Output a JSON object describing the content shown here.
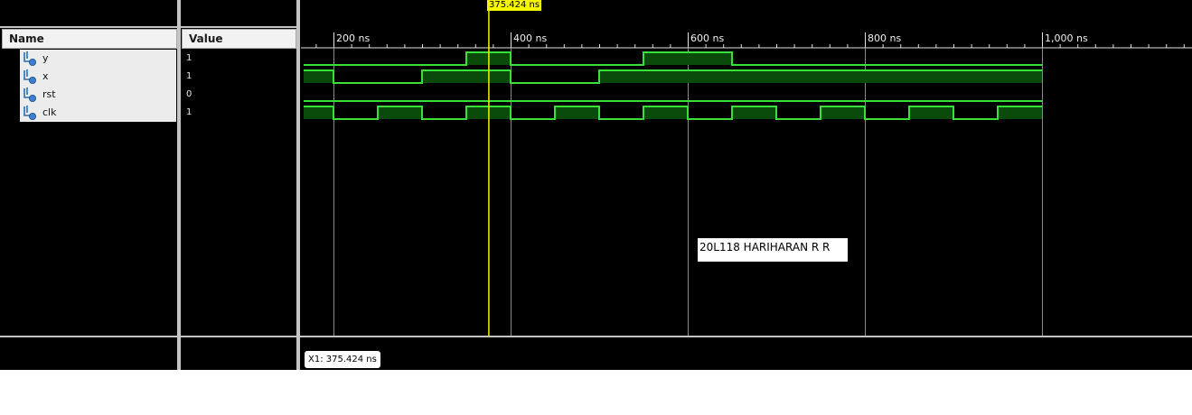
{
  "columns": {
    "name": "Name",
    "value": "Value"
  },
  "signals": [
    {
      "name": "y",
      "value": "1",
      "icon": "signal-bit-icon"
    },
    {
      "name": "x",
      "value": "1",
      "icon": "signal-bit-icon"
    },
    {
      "name": "rst",
      "value": "0",
      "icon": "signal-bit-icon"
    },
    {
      "name": "clk",
      "value": "1",
      "icon": "signal-bit-icon"
    }
  ],
  "timeline": {
    "units": "ns",
    "ticks": [
      "200 ns",
      "400 ns",
      "600 ns",
      "800 ns",
      "1,000 ns"
    ]
  },
  "waveforms": {
    "time_range_ns": [
      167,
      1000
    ],
    "y": [
      [
        167,
        0
      ],
      [
        350,
        1
      ],
      [
        400,
        0
      ],
      [
        550,
        1
      ],
      [
        650,
        0
      ],
      [
        1000,
        0
      ]
    ],
    "x": [
      [
        167,
        1
      ],
      [
        200,
        0
      ],
      [
        300,
        1
      ],
      [
        400,
        0
      ],
      [
        500,
        1
      ],
      [
        1000,
        1
      ]
    ],
    "rst": [
      [
        167,
        0
      ],
      [
        1000,
        0
      ]
    ],
    "clk": [
      [
        167,
        1
      ],
      [
        200,
        0
      ],
      [
        250,
        1
      ],
      [
        300,
        0
      ],
      [
        350,
        1
      ],
      [
        400,
        0
      ],
      [
        450,
        1
      ],
      [
        500,
        0
      ],
      [
        550,
        1
      ],
      [
        600,
        0
      ],
      [
        650,
        1
      ],
      [
        700,
        0
      ],
      [
        750,
        1
      ],
      [
        800,
        0
      ],
      [
        850,
        1
      ],
      [
        900,
        0
      ],
      [
        950,
        1
      ],
      [
        1000,
        1
      ]
    ]
  },
  "cursor": {
    "time_ns": 375.424,
    "label": "375.424 ns",
    "readout": "X1: 375.424 ns",
    "color": "#f5f500"
  },
  "annotation": "20L118 HARIHARAN R R",
  "colors": {
    "wave": "#38e038",
    "wave_fill": "#0a4a0a",
    "background": "#000000"
  }
}
